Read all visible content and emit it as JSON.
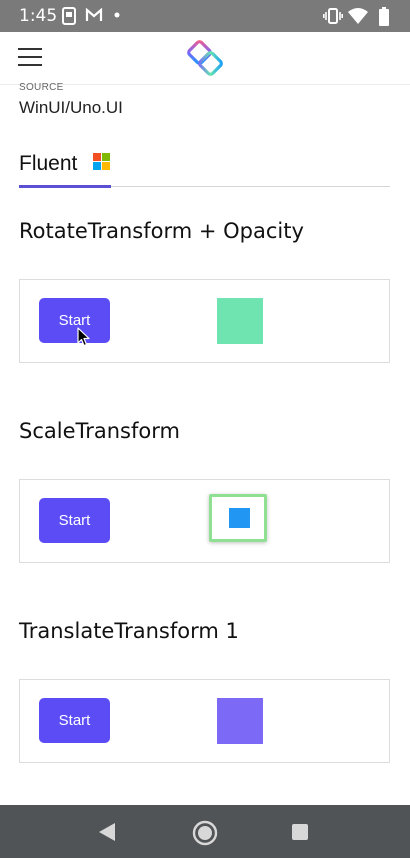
{
  "status_bar": {
    "time": "1:45"
  },
  "source": {
    "label": "SOURCE",
    "value": "WinUI/Uno.UI"
  },
  "tabs": [
    {
      "label": "Fluent"
    }
  ],
  "sections": [
    {
      "title": "RotateTransform + Opacity",
      "button_label": "Start"
    },
    {
      "title": "ScaleTransform",
      "button_label": "Start"
    },
    {
      "title": "TranslateTransform 1",
      "button_label": "Start"
    }
  ],
  "colors": {
    "accent": "#5b4cf5",
    "rotate_square": "#6fe4b1",
    "scale_square": "#2196f3",
    "scale_border": "#8fe093",
    "translate_square": "#7c6af6"
  },
  "icons": {
    "status": [
      "photo-notification-icon",
      "gmail-icon",
      "dot-icon",
      "vibrate-icon",
      "wifi-icon",
      "battery-icon"
    ],
    "app_bar": [
      "hamburger-menu-icon",
      "uno-platform-logo"
    ],
    "tab": "microsoft-logo-icon",
    "nav": [
      "back-icon",
      "home-icon",
      "recent-apps-icon"
    ]
  }
}
